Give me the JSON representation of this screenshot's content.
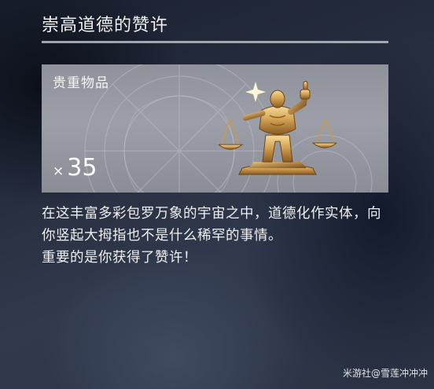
{
  "title": "崇高道德的赞许",
  "item_card": {
    "rarity_label": "贵重物品",
    "quantity_prefix": "×",
    "quantity": "35",
    "icon_name": "golden-scales-thumbs-up-icon"
  },
  "description": {
    "line1": "在这丰富多彩包罗万象的宇宙之中，道德化作实体，向你竖起大拇指也不是什么稀罕的事情。",
    "line2": "重要的是你获得了赞许！"
  },
  "watermark": "米游社@雪莲冲冲冲",
  "colors": {
    "card_background": "#9a9da6",
    "icon_gold": "#d4a456",
    "text": "#f0f0f0"
  }
}
